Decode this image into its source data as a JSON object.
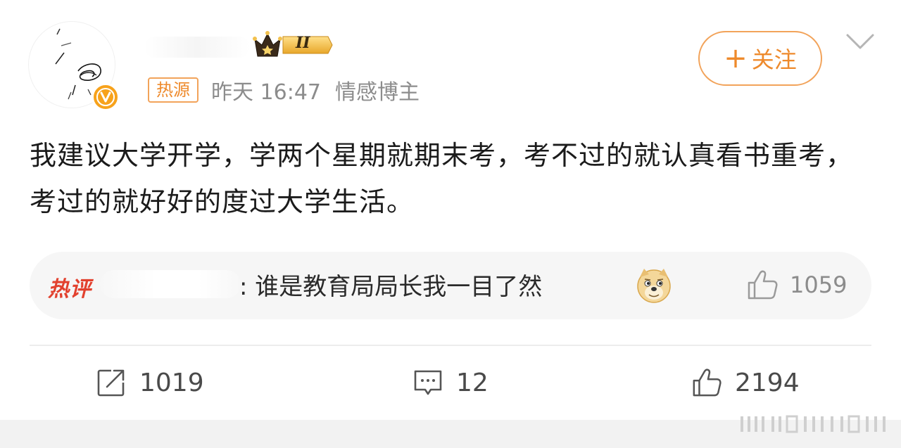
{
  "header": {
    "crown_level": "II",
    "source_tag": "热源",
    "time": "昨天 16:47",
    "role": "情感博主",
    "follow_plus": "+",
    "follow_label": "关注"
  },
  "post": {
    "text": "我建议大学开学，学两个星期就期末考，考不过的就认真看书重考，考过的就好好的度过大学生活。"
  },
  "hot_comment": {
    "label": "热评",
    "text": ": 谁是教育局局长我一目了然",
    "likes": "1059"
  },
  "actions": {
    "repost_count": "1019",
    "comment_count": "12",
    "like_count": "2194"
  },
  "colors": {
    "accent": "#ee8a2c",
    "hot_label": "#e2412e",
    "muted": "#8c8c8c",
    "verified": "#f7a21b"
  },
  "icons": {
    "verified": "verified-v-icon",
    "crown": "crown-icon",
    "chevron": "chevron-down-icon",
    "emoji": "doge-emoji-icon",
    "repost": "repost-icon",
    "comment": "comment-icon",
    "like": "thumbs-up-icon"
  }
}
